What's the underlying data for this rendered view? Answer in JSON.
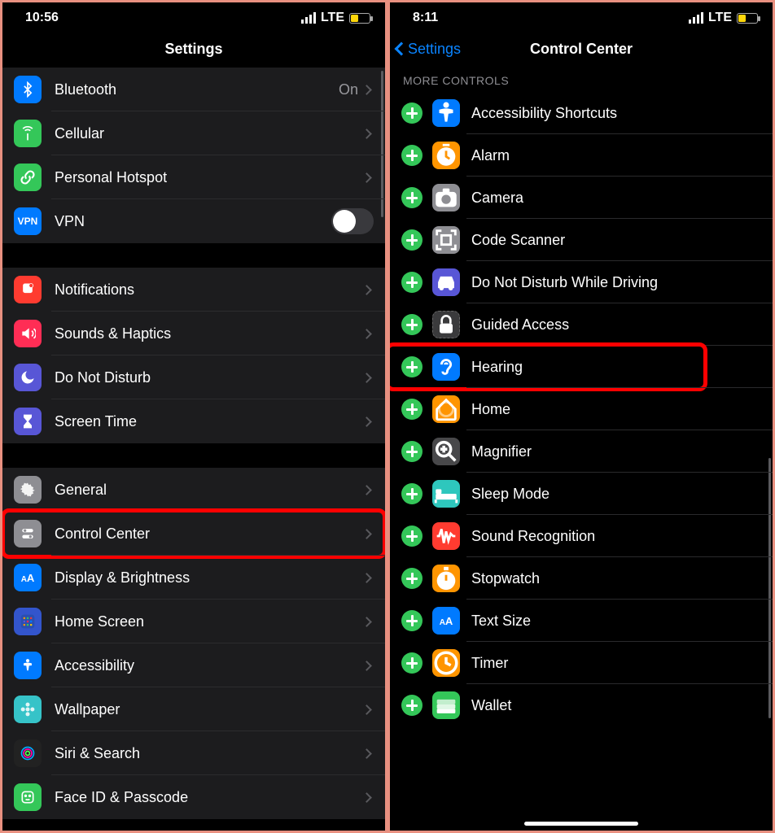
{
  "left": {
    "status": {
      "time": "10:56",
      "network": "LTE"
    },
    "title": "Settings",
    "groups": [
      [
        {
          "id": "bluetooth",
          "label": "Bluetooth",
          "detail": "On",
          "iconBg": "#007aff",
          "icon": "bluetooth"
        },
        {
          "id": "cellular",
          "label": "Cellular",
          "iconBg": "#34c759",
          "icon": "antenna"
        },
        {
          "id": "hotspot",
          "label": "Personal Hotspot",
          "iconBg": "#34c759",
          "icon": "link"
        },
        {
          "id": "vpn",
          "label": "VPN",
          "iconBg": "#007aff",
          "icon": "vpn",
          "toggle": true
        }
      ],
      [
        {
          "id": "notifications",
          "label": "Notifications",
          "iconBg": "#ff3b30",
          "icon": "bell"
        },
        {
          "id": "sounds",
          "label": "Sounds & Haptics",
          "iconBg": "#ff2d55",
          "icon": "speaker"
        },
        {
          "id": "dnd",
          "label": "Do Not Disturb",
          "iconBg": "#5856d6",
          "icon": "moon"
        },
        {
          "id": "screentime",
          "label": "Screen Time",
          "iconBg": "#5856d6",
          "icon": "hourglass"
        }
      ],
      [
        {
          "id": "general",
          "label": "General",
          "iconBg": "#8e8e93",
          "icon": "gear"
        },
        {
          "id": "controlcenter",
          "label": "Control Center",
          "iconBg": "#8e8e93",
          "icon": "switches",
          "highlight": true
        },
        {
          "id": "display",
          "label": "Display & Brightness",
          "iconBg": "#007aff",
          "icon": "AA"
        },
        {
          "id": "homescreen",
          "label": "Home Screen",
          "iconBg": "#3355cc",
          "icon": "grid"
        },
        {
          "id": "accessibility",
          "label": "Accessibility",
          "iconBg": "#007aff",
          "icon": "figure"
        },
        {
          "id": "wallpaper",
          "label": "Wallpaper",
          "iconBg": "#36c3c8",
          "icon": "flower"
        },
        {
          "id": "siri",
          "label": "Siri & Search",
          "iconBg": "#222",
          "icon": "siri"
        },
        {
          "id": "faceid",
          "label": "Face ID & Passcode",
          "iconBg": "#34c759",
          "icon": "face"
        }
      ]
    ]
  },
  "right": {
    "status": {
      "time": "8:11",
      "network": "LTE"
    },
    "backLabel": "Settings",
    "title": "Control Center",
    "sectionHeader": "MORE CONTROLS",
    "controls": [
      {
        "id": "accessibility-shortcuts",
        "label": "Accessibility Shortcuts",
        "iconBg": "#007aff",
        "icon": "figure"
      },
      {
        "id": "alarm",
        "label": "Alarm",
        "iconBg": "#ff9500",
        "icon": "clock"
      },
      {
        "id": "camera",
        "label": "Camera",
        "iconBg": "#8e8e93",
        "icon": "camera"
      },
      {
        "id": "code-scanner",
        "label": "Code Scanner",
        "iconBg": "#8e8e93",
        "icon": "qr"
      },
      {
        "id": "dnd-driving",
        "label": "Do Not Disturb While Driving",
        "iconBg": "#5856d6",
        "icon": "car"
      },
      {
        "id": "guided-access",
        "label": "Guided Access",
        "iconBg": "#3a3a3c",
        "icon": "lock"
      },
      {
        "id": "hearing",
        "label": "Hearing",
        "iconBg": "#007aff",
        "icon": "ear",
        "highlight": true
      },
      {
        "id": "home",
        "label": "Home",
        "iconBg": "#ff9500",
        "icon": "home"
      },
      {
        "id": "magnifier",
        "label": "Magnifier",
        "iconBg": "#48484a",
        "icon": "magnify"
      },
      {
        "id": "sleep-mode",
        "label": "Sleep Mode",
        "iconBg": "#2ec7bd",
        "icon": "bed"
      },
      {
        "id": "sound-recognition",
        "label": "Sound Recognition",
        "iconBg": "#ff3b30",
        "icon": "wave"
      },
      {
        "id": "stopwatch",
        "label": "Stopwatch",
        "iconBg": "#ff9500",
        "icon": "stopwatch"
      },
      {
        "id": "text-size",
        "label": "Text Size",
        "iconBg": "#007aff",
        "icon": "AA"
      },
      {
        "id": "timer",
        "label": "Timer",
        "iconBg": "#ff9500",
        "icon": "timer"
      },
      {
        "id": "wallet",
        "label": "Wallet",
        "iconBg": "#34c759",
        "icon": "wallet"
      }
    ]
  }
}
